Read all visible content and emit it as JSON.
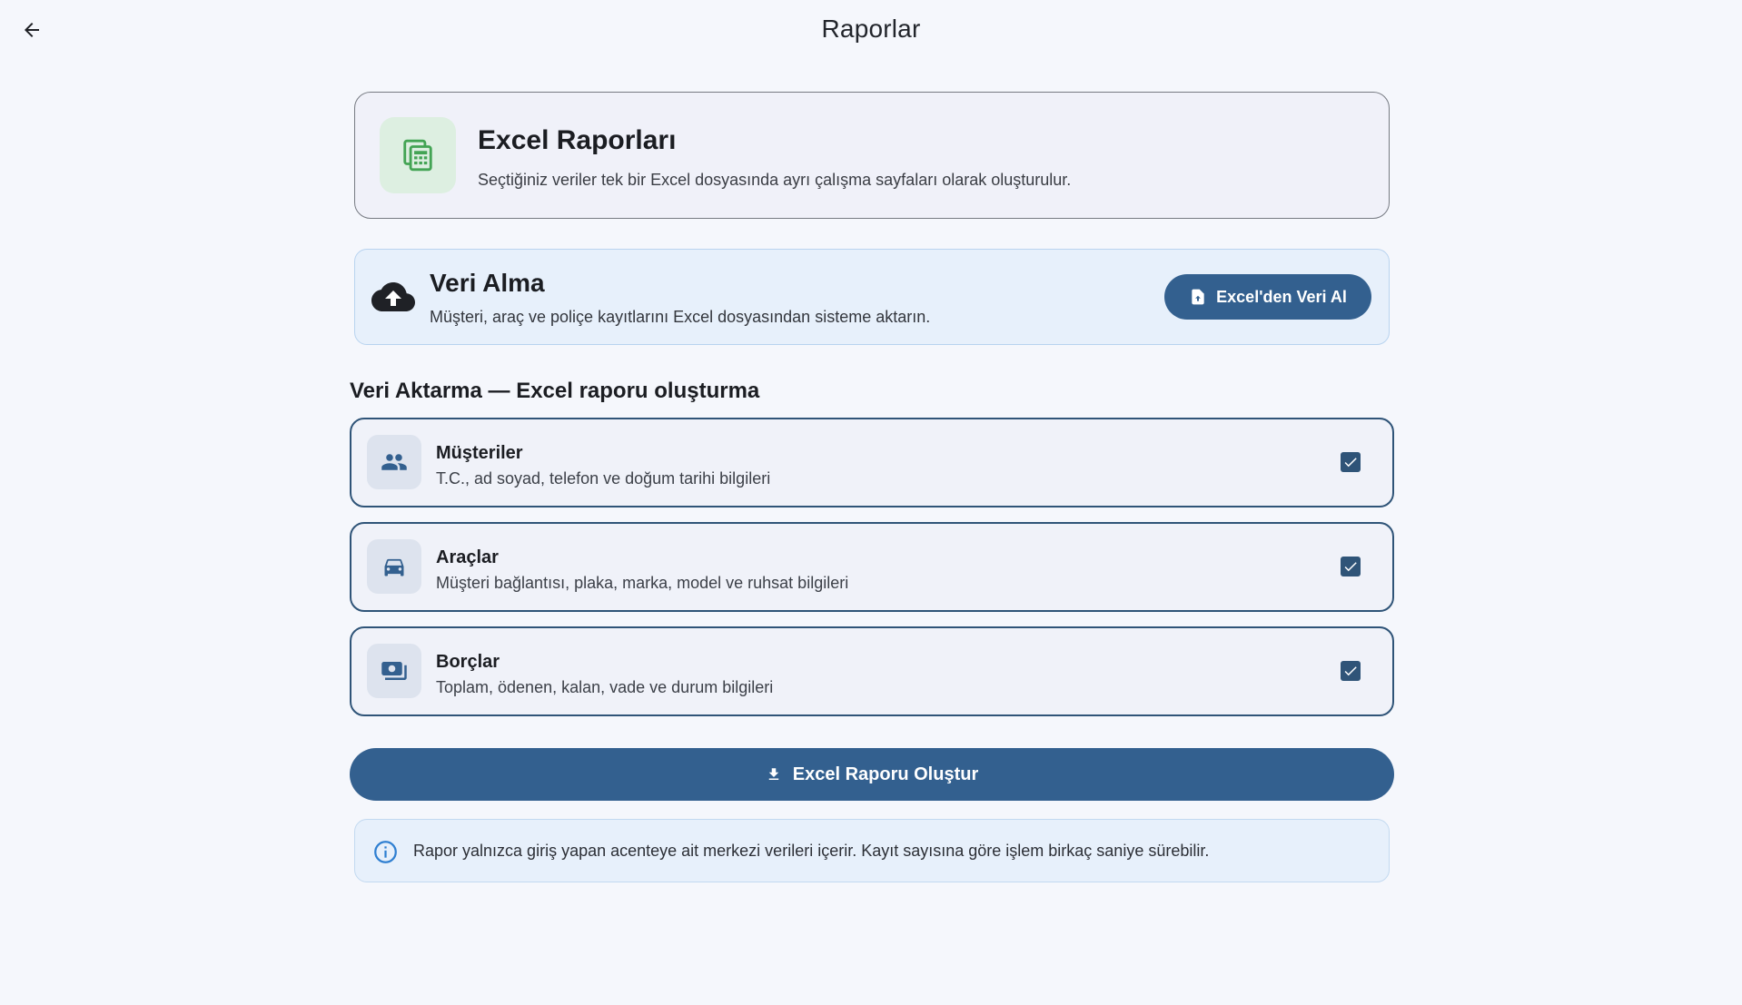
{
  "header": {
    "title": "Raporlar",
    "back_icon": "arrow-left-icon"
  },
  "excel_card": {
    "icon": "spreadsheet-icon",
    "title": "Excel Raporları",
    "description": "Seçtiğiniz veriler tek bir Excel dosyasında ayrı çalışma sayfaları olarak oluşturulur."
  },
  "import_card": {
    "icon": "cloud-upload-icon",
    "title": "Veri Alma",
    "description": "Müşteri, araç ve poliçe kayıtlarını Excel dosyasından sisteme aktarın.",
    "button_icon": "file-upload-icon",
    "button_label": "Excel'den Veri Al"
  },
  "export_section": {
    "title": "Veri Aktarma — Excel raporu oluşturma",
    "options": [
      {
        "icon": "people-icon",
        "title": "Müşteriler",
        "description": "T.C., ad soyad, telefon ve doğum tarihi bilgileri",
        "checked": true
      },
      {
        "icon": "car-icon",
        "title": "Araçlar",
        "description": "Müşteri bağlantısı, plaka, marka, model ve ruhsat bilgileri",
        "checked": true
      },
      {
        "icon": "payments-icon",
        "title": "Borçlar",
        "description": "Toplam, ödenen, kalan, vade ve durum bilgileri",
        "checked": true
      }
    ],
    "generate_button_icon": "download-icon",
    "generate_button_label": "Excel Raporu Oluştur"
  },
  "info": {
    "icon": "info-icon",
    "text": "Rapor yalnızca giriş yapan acenteye ait merkezi verileri içerir. Kayıt sayısına göre işlem birkaç saniye sürebilir."
  },
  "colors": {
    "background": "#f5f7fc",
    "primary": "#33608f",
    "option_border": "#2f5478",
    "excel_green": "#43a454",
    "info_blue": "#2f7fd1"
  }
}
